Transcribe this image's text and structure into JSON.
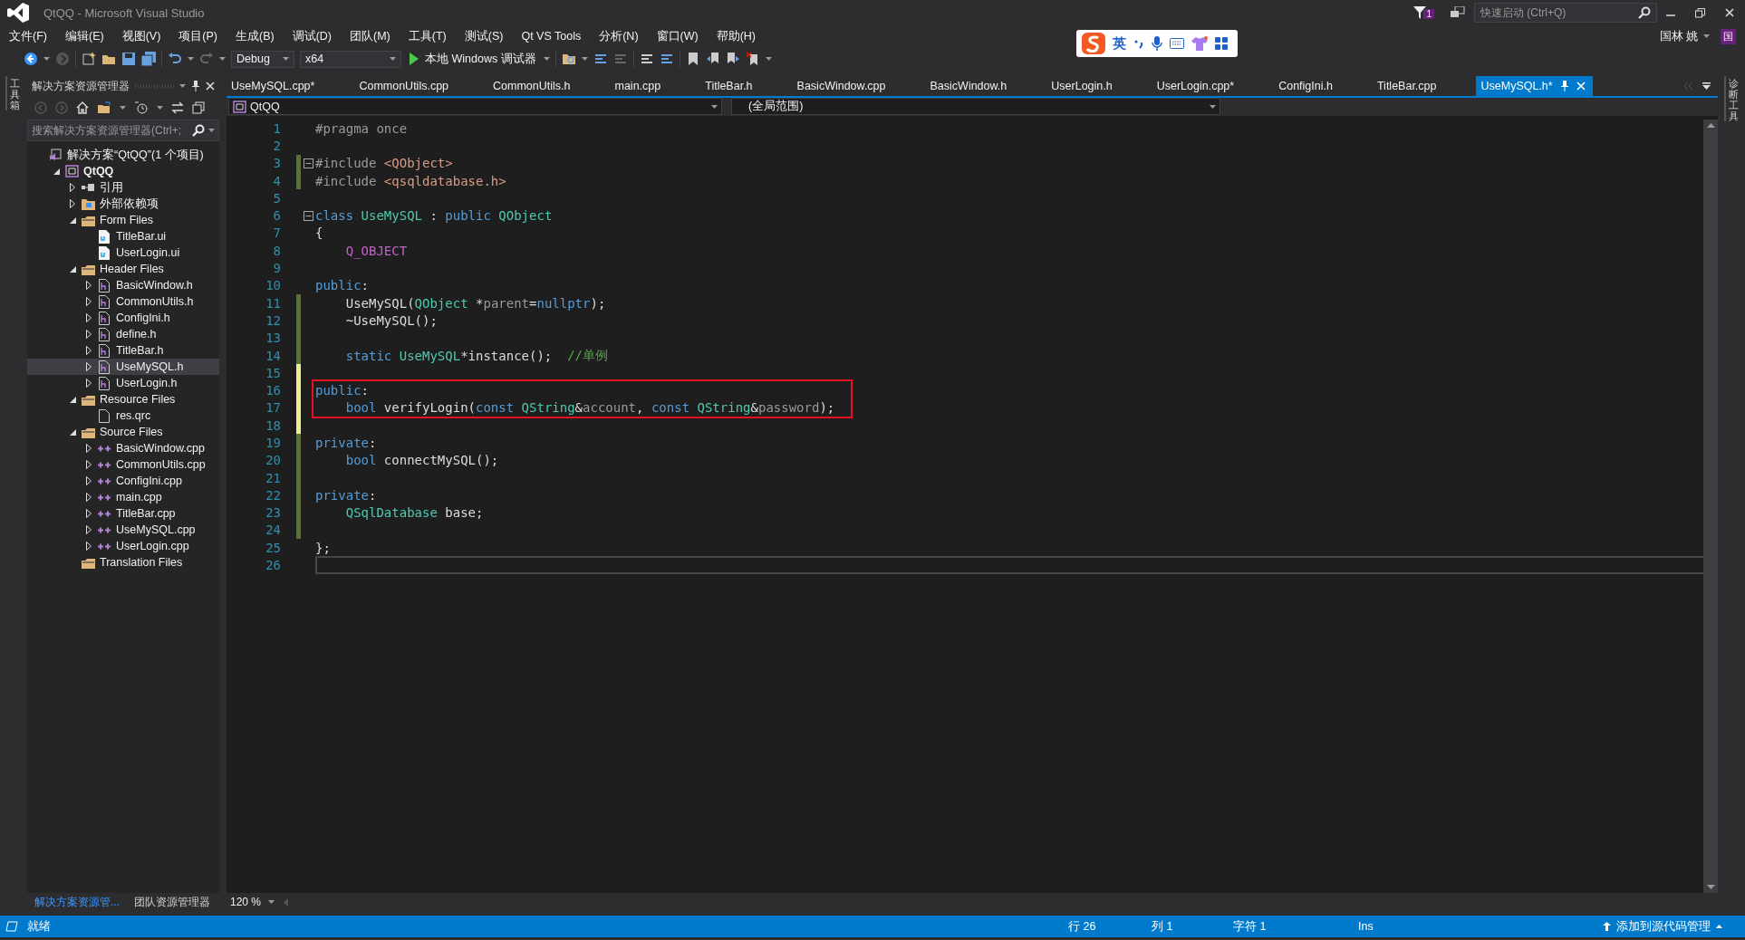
{
  "window": {
    "title": "QtQQ - Microsoft Visual Studio",
    "notifications": "1",
    "quick_launch": {
      "placeholder": "快速启动 (Ctrl+Q)"
    },
    "user": "国林 姚",
    "avatar": "国"
  },
  "ime_bar": {
    "mode": "英"
  },
  "menu": [
    "文件(F)",
    "编辑(E)",
    "视图(V)",
    "项目(P)",
    "生成(B)",
    "调试(D)",
    "团队(M)",
    "工具(T)",
    "测试(S)",
    "Qt VS Tools",
    "分析(N)",
    "窗口(W)",
    "帮助(H)"
  ],
  "toolbar": {
    "configuration": "Debug",
    "platform": "x64",
    "debugger": "本地 Windows 调试器"
  },
  "left_strip": "工具箱",
  "right_strip": "诊断工具",
  "solution_explorer": {
    "title": "解决方案资源管理器",
    "search": {
      "placeholder": "搜索解决方案资源管理器(Ctrl+;"
    },
    "tree": [
      {
        "label": "解决方案“QtQQ”(1 个项目)",
        "kind": "solution",
        "selected": false,
        "children": [
          {
            "label": "QtQQ",
            "kind": "project",
            "expanded": true,
            "selected": false,
            "children": [
              {
                "label": "引用",
                "kind": "references",
                "expanded": false,
                "selected": false
              },
              {
                "label": "外部依赖项",
                "kind": "external",
                "expanded": false,
                "selected": false
              },
              {
                "label": "Form Files",
                "kind": "filter",
                "expanded": true,
                "selected": false,
                "children": [
                  {
                    "label": "TitleBar.ui",
                    "kind": "ui",
                    "selected": false
                  },
                  {
                    "label": "UserLogin.ui",
                    "kind": "ui",
                    "selected": false
                  }
                ]
              },
              {
                "label": "Header Files",
                "kind": "filter",
                "expanded": true,
                "selected": false,
                "children": [
                  {
                    "label": "BasicWindow.h",
                    "kind": "header",
                    "expanded": false,
                    "selected": false
                  },
                  {
                    "label": "CommonUtils.h",
                    "kind": "header",
                    "expanded": false,
                    "selected": false
                  },
                  {
                    "label": "ConfigIni.h",
                    "kind": "header",
                    "expanded": false,
                    "selected": false
                  },
                  {
                    "label": "define.h",
                    "kind": "header",
                    "expanded": false,
                    "selected": false
                  },
                  {
                    "label": "TitleBar.h",
                    "kind": "header",
                    "expanded": false,
                    "selected": false
                  },
                  {
                    "label": "UseMySQL.h",
                    "kind": "header",
                    "expanded": false,
                    "selected": true
                  },
                  {
                    "label": "UserLogin.h",
                    "kind": "header",
                    "expanded": false,
                    "selected": false
                  }
                ]
              },
              {
                "label": "Resource Files",
                "kind": "filter",
                "expanded": true,
                "selected": false,
                "children": [
                  {
                    "label": "res.qrc",
                    "kind": "resource",
                    "selected": false
                  }
                ]
              },
              {
                "label": "Source Files",
                "kind": "filter",
                "expanded": true,
                "selected": false,
                "children": [
                  {
                    "label": "BasicWindow.cpp",
                    "kind": "source",
                    "expanded": false,
                    "selected": false
                  },
                  {
                    "label": "CommonUtils.cpp",
                    "kind": "source",
                    "expanded": false,
                    "selected": false
                  },
                  {
                    "label": "ConfigIni.cpp",
                    "kind": "source",
                    "expanded": false,
                    "selected": false
                  },
                  {
                    "label": "main.cpp",
                    "kind": "source",
                    "expanded": false,
                    "selected": false
                  },
                  {
                    "label": "TitleBar.cpp",
                    "kind": "source",
                    "expanded": false,
                    "selected": false
                  },
                  {
                    "label": "UseMySQL.cpp",
                    "kind": "source",
                    "expanded": false,
                    "selected": false
                  },
                  {
                    "label": "UserLogin.cpp",
                    "kind": "source",
                    "expanded": false,
                    "selected": false
                  }
                ]
              },
              {
                "label": "Translation Files",
                "kind": "filter",
                "selected": false
              }
            ]
          }
        ]
      }
    ],
    "bottom_tabs": [
      {
        "label": "解决方案资源管...",
        "selected": true
      },
      {
        "label": "团队资源管理器",
        "selected": false
      }
    ]
  },
  "tabs": [
    {
      "label": "UseMySQL.cpp*",
      "selected": false
    },
    {
      "label": "CommonUtils.cpp",
      "selected": false
    },
    {
      "label": "CommonUtils.h",
      "selected": false
    },
    {
      "label": "main.cpp",
      "selected": false
    },
    {
      "label": "TitleBar.h",
      "selected": false
    },
    {
      "label": "BasicWindow.cpp",
      "selected": false
    },
    {
      "label": "BasicWindow.h",
      "selected": false
    },
    {
      "label": "UserLogin.h",
      "selected": false
    },
    {
      "label": "UserLogin.cpp*",
      "selected": false
    },
    {
      "label": "ConfigIni.h",
      "selected": false
    },
    {
      "label": "TitleBar.cpp",
      "selected": false
    },
    {
      "label": "UseMySQL.h*",
      "selected": true
    }
  ],
  "editor": {
    "project": "QtQQ",
    "scope": "(全局范围)",
    "zoom": "120 %",
    "lines": [
      {
        "number": "1",
        "modified": false,
        "fold": false,
        "current": false,
        "boxed": false,
        "tokens": [
          {
            "kind": "pre",
            "text": "#pragma once"
          }
        ]
      },
      {
        "number": "2",
        "modified": false,
        "fold": false,
        "current": false,
        "boxed": false
      },
      {
        "number": "3",
        "modified": true,
        "saved": true,
        "fold": true,
        "current": false,
        "boxed": false,
        "tokens": [
          {
            "kind": "pre",
            "text": "#include "
          },
          {
            "kind": "str",
            "text": "<QObject>"
          }
        ]
      },
      {
        "number": "4",
        "modified": true,
        "saved": true,
        "fold": false,
        "current": false,
        "boxed": false,
        "tokens": [
          {
            "kind": "pre",
            "text": "#include "
          },
          {
            "kind": "str",
            "text": "<qsqldatabase.h>"
          }
        ]
      },
      {
        "number": "5",
        "modified": false,
        "fold": false,
        "current": false,
        "boxed": false
      },
      {
        "number": "6",
        "modified": false,
        "fold": true,
        "current": false,
        "boxed": false,
        "tokens": [
          {
            "kind": "kw",
            "text": "class"
          },
          {
            "kind": "type",
            "text": " UseMySQL"
          },
          {
            "kind": "plain",
            "text": " : "
          },
          {
            "kind": "kw",
            "text": "public"
          },
          {
            "kind": "type",
            "text": " QObject"
          }
        ]
      },
      {
        "number": "7",
        "modified": false,
        "fold": false,
        "current": false,
        "boxed": false,
        "tokens": [
          {
            "kind": "plain",
            "text": "{"
          }
        ]
      },
      {
        "number": "8",
        "modified": false,
        "fold": false,
        "current": false,
        "boxed": false,
        "tokens": [
          {
            "kind": "macro",
            "text": "    Q_OBJECT"
          }
        ]
      },
      {
        "number": "9",
        "modified": false,
        "fold": false,
        "current": false,
        "boxed": false
      },
      {
        "number": "10",
        "modified": false,
        "fold": false,
        "current": false,
        "boxed": false,
        "tokens": [
          {
            "kind": "kw",
            "text": "public"
          },
          {
            "kind": "plain",
            "text": ":"
          }
        ]
      },
      {
        "number": "11",
        "modified": true,
        "saved": true,
        "fold": false,
        "current": false,
        "boxed": false,
        "tokens": [
          {
            "kind": "plain",
            "text": "    UseMySQL("
          },
          {
            "kind": "type",
            "text": "QObject"
          },
          {
            "kind": "plain",
            "text": " *"
          },
          {
            "kind": "param",
            "text": "parent"
          },
          {
            "kind": "plain",
            "text": "="
          },
          {
            "kind": "kw",
            "text": "nullptr"
          },
          {
            "kind": "plain",
            "text": ");"
          }
        ]
      },
      {
        "number": "12",
        "modified": true,
        "saved": true,
        "fold": false,
        "current": false,
        "boxed": false,
        "tokens": [
          {
            "kind": "plain",
            "text": "    ~UseMySQL();"
          }
        ]
      },
      {
        "number": "13",
        "modified": true,
        "saved": true,
        "fold": false,
        "current": false,
        "boxed": false
      },
      {
        "number": "14",
        "modified": true,
        "saved": true,
        "fold": false,
        "current": false,
        "boxed": false,
        "tokens": [
          {
            "kind": "kw",
            "text": "    static"
          },
          {
            "kind": "type",
            "text": " UseMySQL"
          },
          {
            "kind": "plain",
            "text": "*instance();  "
          },
          {
            "kind": "comment",
            "text": "//单例"
          }
        ]
      },
      {
        "number": "15",
        "modified": true,
        "saved": false,
        "fold": false,
        "current": false,
        "boxed": false
      },
      {
        "number": "16",
        "modified": true,
        "saved": false,
        "fold": false,
        "current": false,
        "boxed": true,
        "tokens": [
          {
            "kind": "kw",
            "text": "public"
          },
          {
            "kind": "plain",
            "text": ":"
          }
        ]
      },
      {
        "number": "17",
        "modified": true,
        "saved": false,
        "fold": false,
        "current": false,
        "boxed": true,
        "tokens": [
          {
            "kind": "kw",
            "text": "    bool"
          },
          {
            "kind": "plain",
            "text": " verifyLogin("
          },
          {
            "kind": "kw",
            "text": "const"
          },
          {
            "kind": "type",
            "text": " QString"
          },
          {
            "kind": "plain",
            "text": "&"
          },
          {
            "kind": "param",
            "text": "account"
          },
          {
            "kind": "plain",
            "text": ", "
          },
          {
            "kind": "kw",
            "text": "const"
          },
          {
            "kind": "type",
            "text": " QString"
          },
          {
            "kind": "plain",
            "text": "&"
          },
          {
            "kind": "param",
            "text": "password"
          },
          {
            "kind": "plain",
            "text": ");"
          }
        ]
      },
      {
        "number": "18",
        "modified": true,
        "saved": false,
        "fold": false,
        "current": false,
        "boxed": false
      },
      {
        "number": "19",
        "modified": true,
        "saved": true,
        "fold": false,
        "current": false,
        "boxed": false,
        "tokens": [
          {
            "kind": "kw",
            "text": "private"
          },
          {
            "kind": "plain",
            "text": ":"
          }
        ]
      },
      {
        "number": "20",
        "modified": true,
        "saved": true,
        "fold": false,
        "current": false,
        "boxed": false,
        "tokens": [
          {
            "kind": "kw",
            "text": "    bool"
          },
          {
            "kind": "plain",
            "text": " connectMySQL();"
          }
        ]
      },
      {
        "number": "21",
        "modified": true,
        "saved": true,
        "fold": false,
        "current": false,
        "boxed": false
      },
      {
        "number": "22",
        "modified": true,
        "saved": true,
        "fold": false,
        "current": false,
        "boxed": false,
        "tokens": [
          {
            "kind": "kw",
            "text": "private"
          },
          {
            "kind": "plain",
            "text": ":"
          }
        ]
      },
      {
        "number": "23",
        "modified": true,
        "saved": true,
        "fold": false,
        "current": false,
        "boxed": false,
        "tokens": [
          {
            "kind": "type",
            "text": "    QSqlDatabase"
          },
          {
            "kind": "plain",
            "text": " base;"
          }
        ]
      },
      {
        "number": "24",
        "modified": true,
        "saved": true,
        "fold": false,
        "current": false,
        "boxed": false
      },
      {
        "number": "25",
        "modified": false,
        "fold": false,
        "current": false,
        "boxed": false,
        "tokens": [
          {
            "kind": "plain",
            "text": "};"
          }
        ]
      },
      {
        "number": "26",
        "modified": false,
        "fold": false,
        "current": true,
        "boxed": false
      }
    ]
  },
  "status_bar": {
    "message": "就绪",
    "line": "行 26",
    "column": "列 1",
    "char": "字符 1",
    "mode": "Ins",
    "source_control": "添加到源代码管理"
  }
}
